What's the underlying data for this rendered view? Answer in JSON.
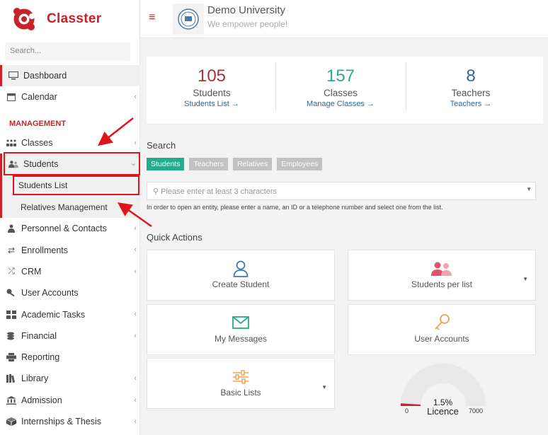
{
  "app": {
    "brand": "Classter"
  },
  "sidebar": {
    "search_placeholder": "Search...",
    "top_items": [
      {
        "label": "Dashboard",
        "icon": "monitor-icon"
      },
      {
        "label": "Calendar",
        "icon": "calendar-icon"
      }
    ],
    "section_label": "MANAGEMENT",
    "items": [
      {
        "label": "Classes",
        "icon": "classes-icon"
      },
      {
        "label": "Students",
        "icon": "users-icon"
      },
      {
        "label": "Personnel & Contacts",
        "icon": "person-icon"
      },
      {
        "label": "Enrollments",
        "icon": "arrows-icon"
      },
      {
        "label": "CRM",
        "icon": "shuffle-icon"
      },
      {
        "label": "User Accounts",
        "icon": "key-icon"
      },
      {
        "label": "Academic Tasks",
        "icon": "grid-icon"
      },
      {
        "label": "Financial",
        "icon": "coins-icon"
      },
      {
        "label": "Reporting",
        "icon": "printer-icon"
      },
      {
        "label": "Library",
        "icon": "books-icon"
      },
      {
        "label": "Admission",
        "icon": "bank-icon"
      },
      {
        "label": "Internships & Thesis",
        "icon": "box-icon"
      }
    ],
    "sub_items": [
      {
        "label": "Students List"
      },
      {
        "label": "Relatives Management"
      }
    ]
  },
  "header": {
    "institution": "Demo University",
    "tagline": "We empower people!"
  },
  "stats": [
    {
      "value": "105",
      "label": "Students",
      "link": "Students List",
      "color": "#a8323a"
    },
    {
      "value": "157",
      "label": "Classes",
      "link": "Manage Classes",
      "color": "#2aa98b"
    },
    {
      "value": "8",
      "label": "Teachers",
      "link": "Teachers",
      "color": "#2a6a9e"
    }
  ],
  "search": {
    "title": "Search",
    "tabs": [
      "Students",
      "Teachers",
      "Relatives",
      "Employees"
    ],
    "placeholder": "Please enter at least 3 characters",
    "hint": "In order to open an entity, please enter a name, an ID or a telephone number and select one from the list."
  },
  "quick_actions": {
    "title": "Quick Actions",
    "cards": [
      {
        "label": "Create Student",
        "icon": "user-outline-icon",
        "color": "#3a7bb6"
      },
      {
        "label": "Students per list",
        "icon": "users-pair-icon",
        "color": "#e0526e"
      },
      {
        "label": "My Messages",
        "icon": "envelope-icon",
        "color": "#2aa98b"
      },
      {
        "label": "User Accounts",
        "icon": "key-icon",
        "color": "#f0a050"
      },
      {
        "label": "Basic Lists",
        "icon": "sliders-icon",
        "color": "#f0a050"
      }
    ]
  },
  "licence": {
    "percent": "1.5%",
    "label": "Licence",
    "min": "0",
    "max": "7000",
    "fill_fraction": 0.015
  }
}
